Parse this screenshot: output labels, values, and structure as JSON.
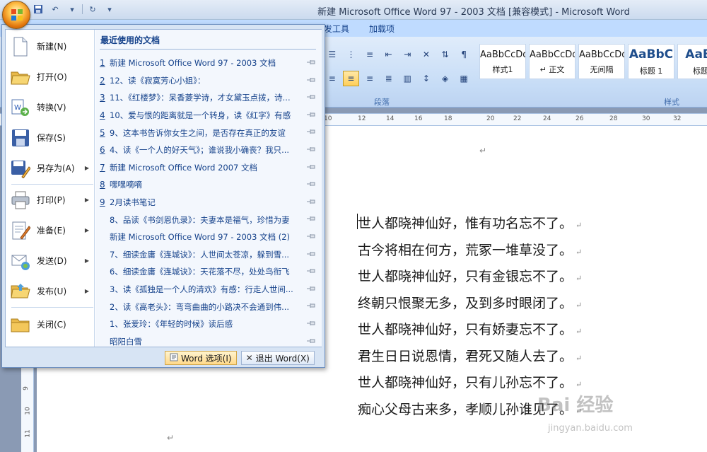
{
  "window": {
    "title": "新建 Microsoft Office Word 97 - 2003 文档 [兼容模式] - Microsoft Word"
  },
  "ribbon": {
    "tabs": [
      "发工具",
      "加载项"
    ],
    "groups": {
      "paragraph": "段落",
      "styles": "样式"
    },
    "styles": [
      {
        "sample": "AaBbCcDd",
        "name": "样式1"
      },
      {
        "sample": "AaBbCcDd",
        "name": "↵ 正文"
      },
      {
        "sample": "AaBbCcDd",
        "name": "无间隔"
      },
      {
        "sample": "AaBbC",
        "name": "标题 1"
      },
      {
        "sample": "AaBl",
        "name": "标题"
      }
    ]
  },
  "ruler": [
    "10",
    "12",
    "14",
    "16",
    "18",
    "20",
    "22",
    "24",
    "26",
    "28",
    "30",
    "32"
  ],
  "vruler": [
    "9",
    "10",
    "11"
  ],
  "office_menu": {
    "left_items": [
      {
        "label": "新建(N)",
        "icon": "new-document-icon",
        "arrow": false
      },
      {
        "label": "打开(O)",
        "icon": "open-folder-icon",
        "arrow": false
      },
      {
        "label": "转换(V)",
        "icon": "convert-icon",
        "arrow": false
      },
      {
        "label": "保存(S)",
        "icon": "save-icon",
        "arrow": false
      },
      {
        "label": "另存为(A)",
        "icon": "save-as-icon",
        "arrow": true
      },
      {
        "label": "打印(P)",
        "icon": "print-icon",
        "arrow": true
      },
      {
        "label": "准备(E)",
        "icon": "prepare-icon",
        "arrow": true
      },
      {
        "label": "发送(D)",
        "icon": "send-icon",
        "arrow": true
      },
      {
        "label": "发布(U)",
        "icon": "publish-icon",
        "arrow": true
      },
      {
        "label": "关闭(C)",
        "icon": "close-folder-icon",
        "arrow": false
      }
    ],
    "recent_title": "最近使用的文档",
    "recent_docs": [
      {
        "num": "1",
        "name": "新建 Microsoft Office Word 97 - 2003 文档"
      },
      {
        "num": "2",
        "name": "12、读《寂寞芳心小姐》："
      },
      {
        "num": "3",
        "name": "11、《红楼梦》：呆香菱学诗，才女黛玉点拨，诗..."
      },
      {
        "num": "4",
        "name": "10、爱与恨的距离就是一个转身，读《红字》有感"
      },
      {
        "num": "5",
        "name": "9、这本书告诉你女生之间，是否存在真正的友谊"
      },
      {
        "num": "6",
        "name": "4、读《一个人的好天气》；谁说我小确丧？我只..."
      },
      {
        "num": "7",
        "name": "新建 Microsoft Office Word 2007 文档"
      },
      {
        "num": "8",
        "name": "嘿嘿嘀嘀"
      },
      {
        "num": "9",
        "name": "2月读书笔记"
      },
      {
        "num": "",
        "name": "8、品读《书剑恩仇录》：夫妻本是福气，珍惜为妻"
      },
      {
        "num": "",
        "name": "新建 Microsoft Office Word 97 - 2003 文档 (2)"
      },
      {
        "num": "",
        "name": "7、细读金庸《连城诀》：人世间太苍凉，躲到雪..."
      },
      {
        "num": "",
        "name": "6、细读金庸《连城诀》：天花落不尽，处处鸟衔飞"
      },
      {
        "num": "",
        "name": "3、读《孤独是一个人的清欢》有感：行走人世间..."
      },
      {
        "num": "",
        "name": "2、读《高老头》：弯弯曲曲的小路决不会通到伟..."
      },
      {
        "num": "",
        "name": "1、张爱玲：《年轻的时候》读后感"
      },
      {
        "num": "",
        "name": "昭阳白雪"
      }
    ],
    "word_options_label": "Word 选项(I)",
    "exit_label": "退出 Word(X)"
  },
  "document": {
    "lines": [
      "世人都晓神仙好，惟有功名忘不了。",
      "古今将相在何方，荒冢一堆草没了。",
      "世人都晓神仙好，只有金银忘不了。",
      "终朝只恨聚无多，及到多时眼闭了。",
      "世人都晓神仙好，只有娇妻忘不了。",
      "君生日日说恩情，君死又随人去了。",
      "世人都晓神仙好，只有儿孙忘不了。",
      "痴心父母古来多，孝顺儿孙谁见了。"
    ],
    "para_mark": "↵"
  },
  "watermark": {
    "main": "Bai 经验",
    "sub": "jingyan.baidu.com"
  }
}
